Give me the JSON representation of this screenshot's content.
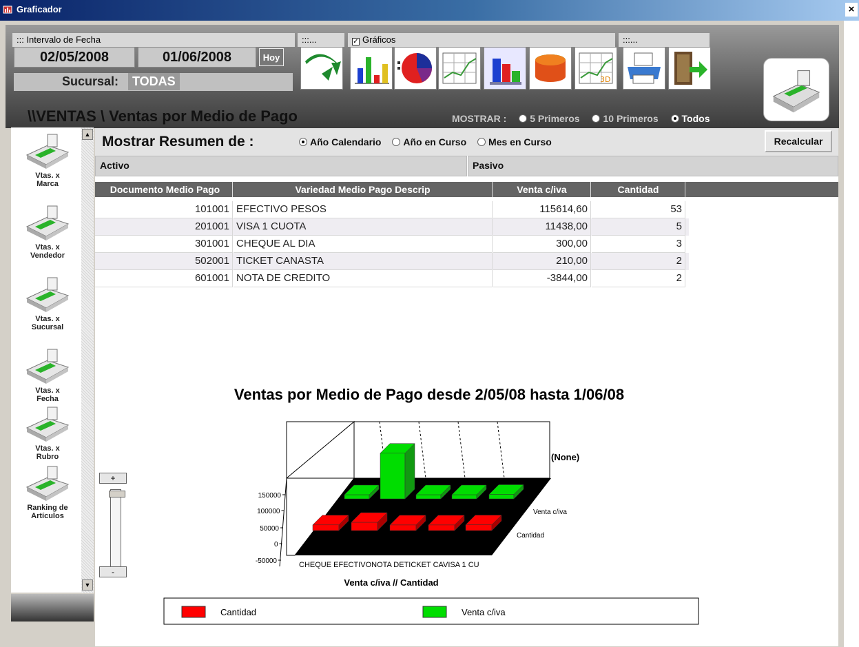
{
  "window": {
    "title": "Graficador",
    "close": "×"
  },
  "toolbar": {
    "fecha_panel_title": "::: Intervalo de Fecha",
    "date_from": "02/05/2008",
    "date_to": "01/06/2008",
    "hoy_label": "Hoy",
    "sucursal_label": "Sucursal:",
    "sucursal_value": "TODAS",
    "panel2_title": ":::...",
    "graficos_label": "Gráficos",
    "graficos_checked": true,
    "panel4_title": ":::...",
    "buttons": [
      "refresh-icon",
      "bar-chart-icon",
      "pie-chart-icon",
      "line-chart-icon",
      "bar-3d-icon",
      "cylinder-chart-icon",
      "line-chart-3d-icon",
      "print-icon",
      "exit-icon"
    ]
  },
  "heading": "\\\\VENTAS \\ Ventas por Medio de Pago",
  "mostrar": {
    "label": "MOSTRAR :",
    "options": [
      "5 Primeros",
      "10 Primeros",
      "Todos"
    ],
    "selected": "Todos"
  },
  "sidebar": {
    "items": [
      {
        "label": "Vtas. x Marca"
      },
      {
        "label": "Vtas. x Vendedor"
      },
      {
        "label": "Vtas. x Sucursal"
      },
      {
        "label": "Vtas. x Fecha"
      },
      {
        "label": "Vtas. x Rubro"
      },
      {
        "label": "Ranking de Artículos"
      }
    ]
  },
  "resumen": {
    "label": "Mostrar Resumen de :",
    "options": [
      "Año Calendario",
      "Año en Curso",
      "Mes en Curso"
    ],
    "selected": "Año Calendario",
    "recalc": "Recalcular"
  },
  "groups": {
    "activo": "Activo",
    "pasivo": "Pasivo"
  },
  "table": {
    "headers": [
      "Documento Medio Pago",
      "Variedad Medio Pago Descrip",
      "Venta c/iva",
      "Cantidad"
    ],
    "rows": [
      [
        "101001",
        "EFECTIVO PESOS",
        "115614,60",
        "53"
      ],
      [
        "201001",
        "VISA 1 CUOTA",
        "11438,00",
        "5"
      ],
      [
        "301001",
        "CHEQUE AL DIA",
        "300,00",
        "3"
      ],
      [
        "502001",
        "TICKET CANASTA",
        "210,00",
        "2"
      ],
      [
        "601001",
        "NOTA DE CREDITO",
        "-3844,00",
        "2"
      ]
    ]
  },
  "zoom": {
    "plus": "+",
    "minus": "-"
  },
  "chart_data": {
    "type": "bar",
    "title": "Ventas por Medio de Pago desde 2/05/08  hasta 1/06/08",
    "categories": [
      "CHEQUE",
      "EFECTIVO",
      "NOTA DE",
      "TICKET CA",
      "VISA 1 CU"
    ],
    "category_label_text": "CHEQUE EFECTIVONOTA DETICKET CAVISA 1 CU",
    "series": [
      {
        "name": "Venta c/iva",
        "values": [
          300,
          115614.6,
          -3844,
          210,
          11438
        ],
        "color": "#00dd00"
      },
      {
        "name": "Cantidad",
        "values": [
          3,
          53,
          2,
          2,
          5
        ],
        "color": "#ff0000"
      }
    ],
    "yticks": [
      "150000",
      "100000",
      "50000",
      "0",
      "-50000"
    ],
    "ylim": [
      -50000,
      150000
    ],
    "xlabel": "Venta c/iva  //  Cantidad",
    "wall_label": "(None)",
    "legend": [
      "Cantidad",
      "Venta c/iva"
    ],
    "legend_placement": "bottom"
  }
}
